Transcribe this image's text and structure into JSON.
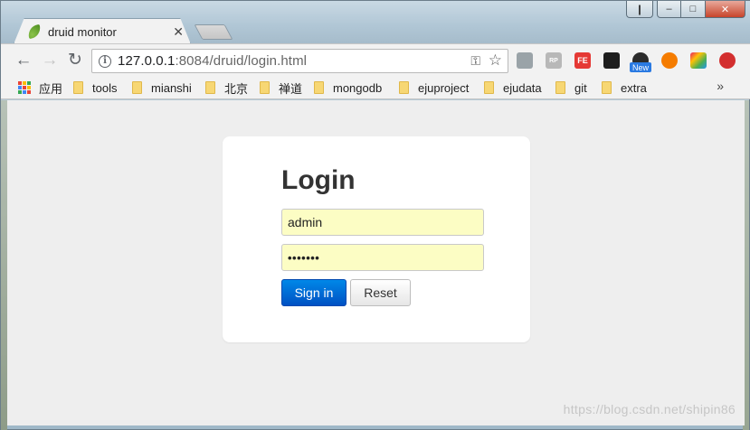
{
  "window": {
    "controls": [
      "❙",
      "–",
      "□",
      "✕"
    ]
  },
  "tab": {
    "title": "druid monitor",
    "close_symbol": "✕",
    "icon": "spring-leaf-icon"
  },
  "toolbar": {
    "back_symbol": "←",
    "forward_symbol": "→",
    "reload_symbol": "↻",
    "url_host": "127.0.0.1",
    "url_rest": ":8084/druid/login.html",
    "key_symbol": "⚿",
    "star_symbol": "☆",
    "extensions": [
      {
        "name": "grid-extension-icon",
        "label": "",
        "color": "#9aa3a8"
      },
      {
        "name": "rp-extension-icon",
        "label": "RP",
        "color": "#b8b8b8"
      },
      {
        "name": "fe-extension-icon",
        "label": "FE",
        "color": "#e53935"
      },
      {
        "name": "tampermonkey-icon",
        "label": "",
        "color": "#1e1e1e"
      },
      {
        "name": "new-badge-extension-icon",
        "label": "New",
        "color": "#2a7ae2"
      },
      {
        "name": "orange-extension-icon",
        "label": "",
        "color": "#f57c00"
      },
      {
        "name": "colorful-extension-icon",
        "label": "",
        "color": "#e91e63"
      },
      {
        "name": "red-upload-extension-icon",
        "label": "",
        "color": "#d32f2f"
      }
    ]
  },
  "bookmarks": {
    "apps_label": "应用",
    "items": [
      "tools",
      "mianshi",
      "北京",
      "禅道",
      "mongodb",
      "ejuproject",
      "ejudata",
      "git",
      "extra"
    ],
    "more_symbol": "»"
  },
  "login": {
    "title": "Login",
    "username_value": "admin",
    "password_value": "•••••••",
    "signin_label": "Sign in",
    "reset_label": "Reset"
  },
  "watermark": "https://blog.csdn.net/shipin86",
  "colors": {
    "field_background": "#fcfdc4",
    "signin_blue": "#0066d6",
    "page_background": "#eeeeee"
  }
}
